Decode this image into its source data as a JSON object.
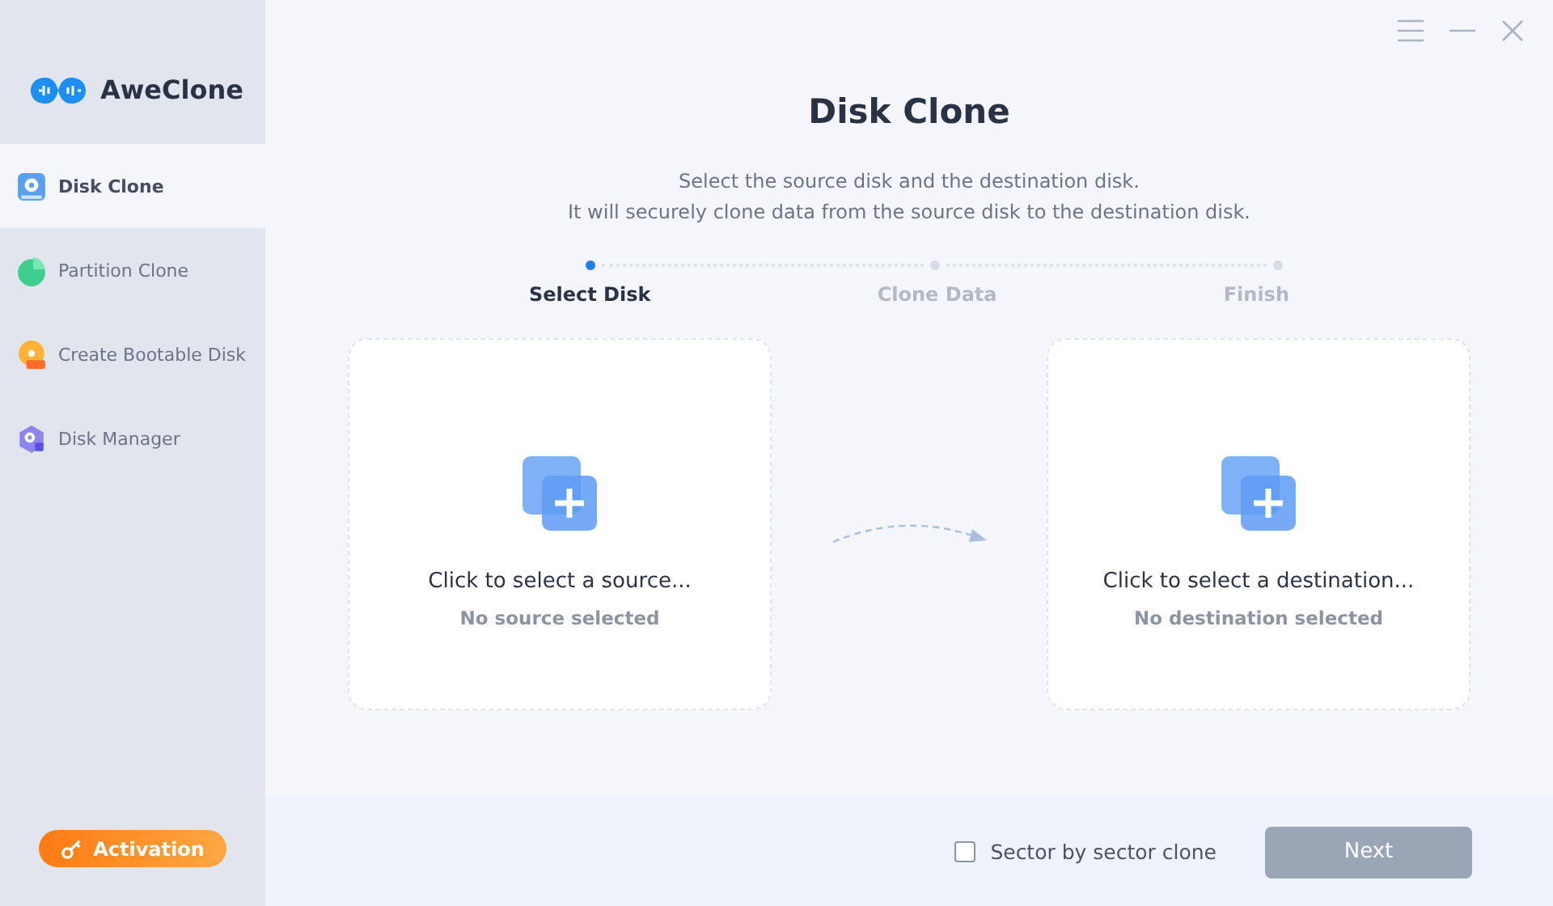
{
  "app": {
    "name": "AweClone"
  },
  "sidebar": {
    "items": [
      {
        "label": "Disk Clone",
        "kind": "disk",
        "selected": true
      },
      {
        "label": "Partition Clone",
        "kind": "partition",
        "selected": false
      },
      {
        "label": "Create Bootable Disk",
        "kind": "bootable",
        "selected": false
      },
      {
        "label": "Disk Manager",
        "kind": "manager",
        "selected": false
      }
    ],
    "activation": "Activation"
  },
  "title": "Disk Clone",
  "subtitle": [
    "Select the source disk and the destination disk.",
    "It will securely clone data from the source disk to the destination disk."
  ],
  "steps": [
    {
      "label": "Select Disk",
      "selected": true
    },
    {
      "label": "Clone Data",
      "selected": false
    },
    {
      "label": "Finish",
      "selected": false
    }
  ],
  "cards": [
    {
      "title": "Click to select a source...",
      "status": "No source selected"
    },
    {
      "title": "Click to select a destination...",
      "status": "No destination selected"
    }
  ],
  "footer": {
    "checkbox": {
      "label": "Sector by sector clone",
      "checked": false
    },
    "next": {
      "label": "Next",
      "disabled": true
    }
  }
}
